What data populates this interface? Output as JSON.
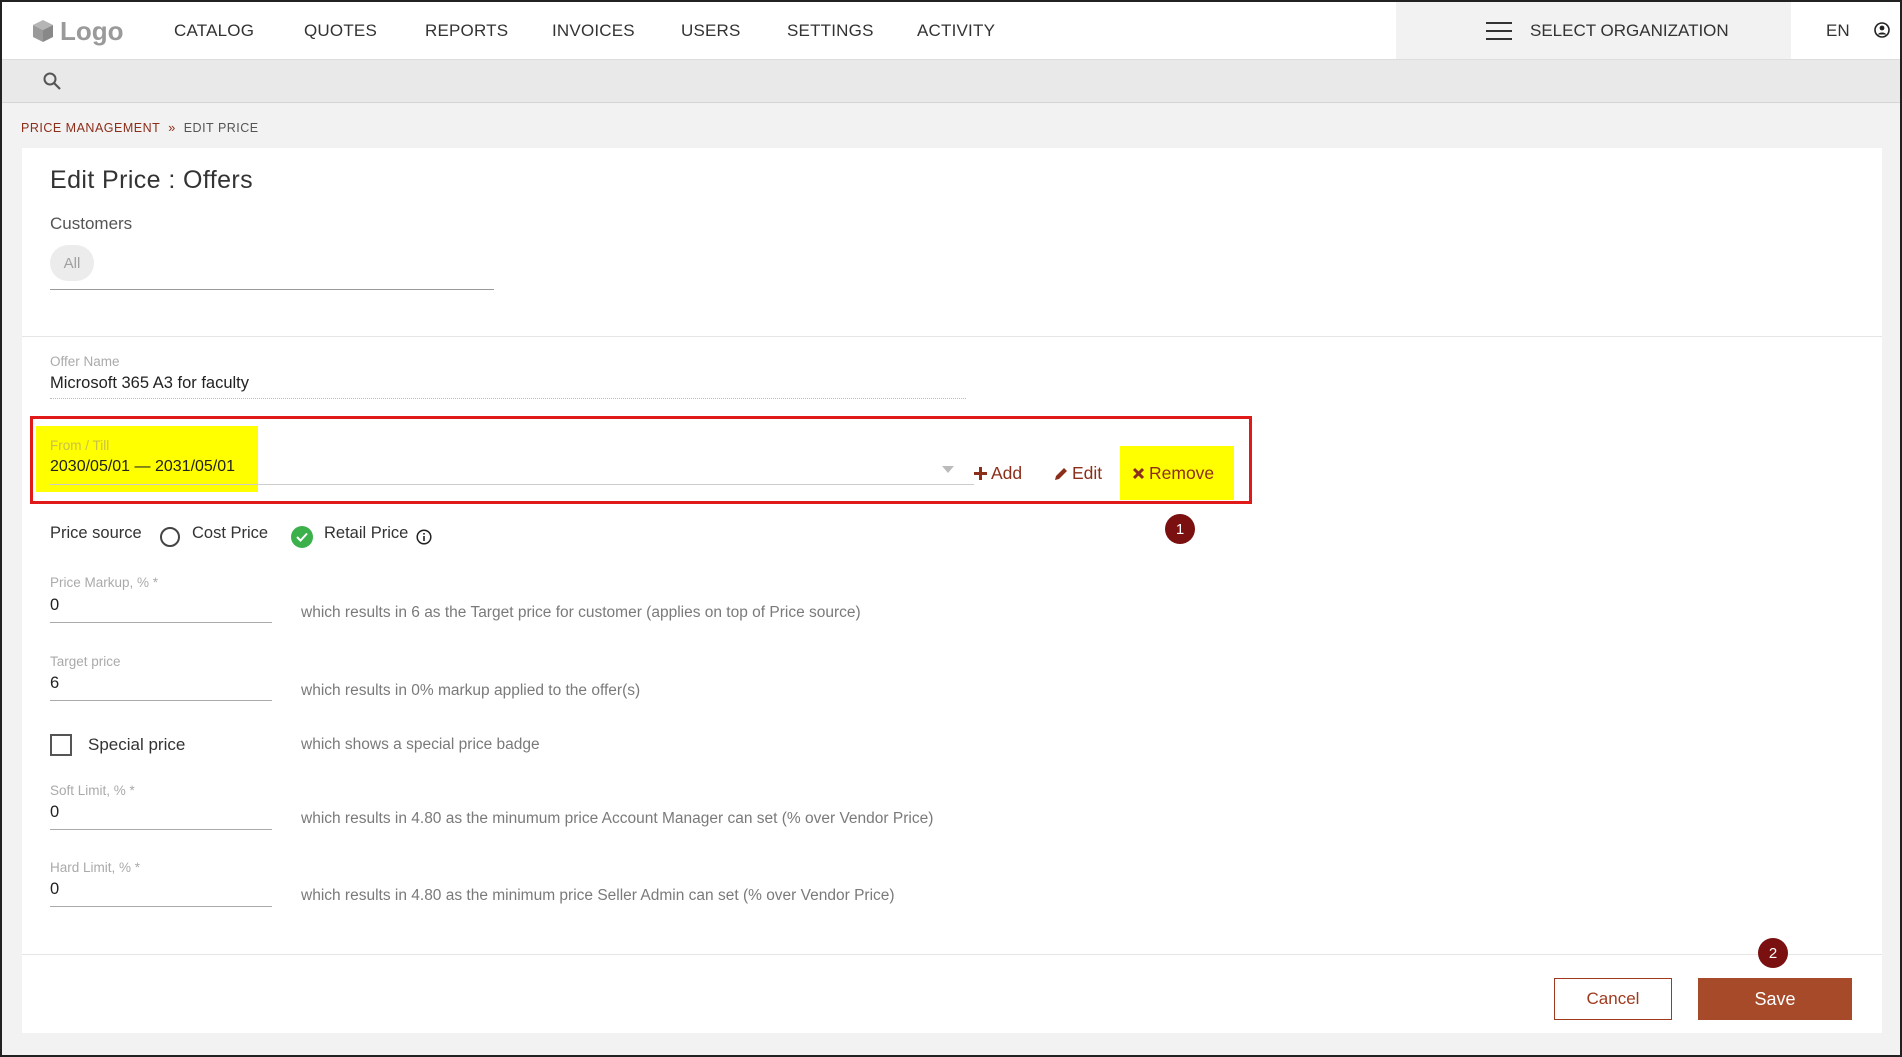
{
  "header": {
    "logo_text": "Logo",
    "nav": [
      "CATALOG",
      "QUOTES",
      "REPORTS",
      "INVOICES",
      "USERS",
      "SETTINGS",
      "ACTIVITY"
    ],
    "org_selector": "SELECT ORGANIZATION",
    "language": "EN"
  },
  "breadcrumb": {
    "parent": "PRICE MANAGEMENT",
    "separator": "»",
    "current": "EDIT PRICE"
  },
  "form": {
    "title": "Edit Price : Offers",
    "customers_label": "Customers",
    "customers_chip": "All",
    "offer_name_label": "Offer Name",
    "offer_name_value": "Microsoft 365 A3 for faculty",
    "period_label": "From / Till",
    "period_value": "2030/05/01 — 2031/05/01",
    "actions": {
      "add": "Add",
      "edit": "Edit",
      "remove": "Remove"
    },
    "price_source": {
      "label": "Price source",
      "options": [
        "Cost Price",
        "Retail Price"
      ],
      "selected": "Retail Price"
    },
    "markup": {
      "label": "Price Markup, % *",
      "value": "0",
      "hint": "which results in 6 as the Target price for customer (applies on top of Price source)"
    },
    "target": {
      "label": "Target price",
      "value": "6",
      "hint": "which results in 0% markup applied to the offer(s)"
    },
    "special": {
      "label": "Special price",
      "checked": false,
      "hint": "which shows a special price badge"
    },
    "soft_limit": {
      "label": "Soft Limit, % *",
      "value": "0",
      "hint": "which results in 4.80 as the minumum price Account Manager can set (% over Vendor Price)"
    },
    "hard_limit": {
      "label": "Hard Limit, % *",
      "value": "0",
      "hint": "which results in 4.80 as the minimum price Seller Admin can set (% over Vendor Price)"
    },
    "buttons": {
      "cancel": "Cancel",
      "save": "Save"
    }
  },
  "annotations": {
    "step1": "1",
    "step2": "2"
  },
  "colors": {
    "accent": "#8b2e1a",
    "save_button": "#a64a2a",
    "highlight": "#ffff00",
    "callout_frame": "#e01919",
    "badge": "#7a1010",
    "radio_checked": "#3cb04a"
  },
  "icons": [
    "logo-cube-icon",
    "menu-icon",
    "user-icon",
    "search-icon",
    "plus-icon",
    "pencil-icon",
    "close-icon",
    "info-icon",
    "check-icon",
    "chevron-down-icon"
  ]
}
